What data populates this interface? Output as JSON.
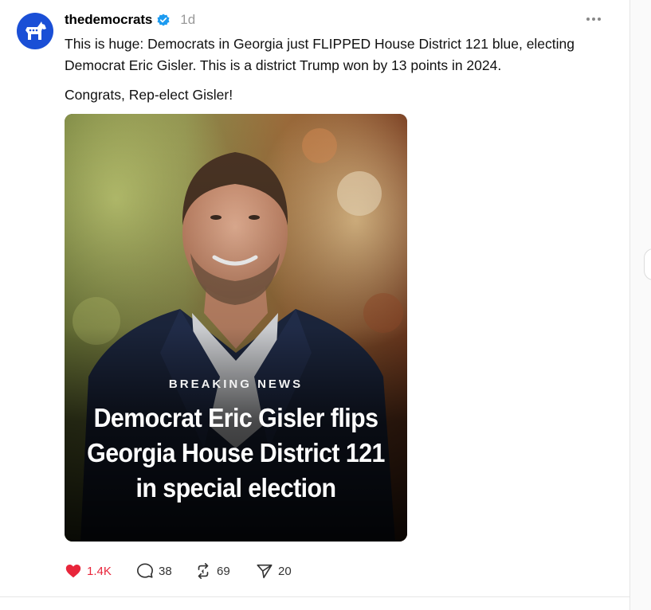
{
  "post": {
    "username": "thedemocrats",
    "timestamp": "1d",
    "paragraphs": [
      "This is huge: Democrats in Georgia just FLIPPED House District 121 blue, electing Democrat Eric Gisler. This is a district Trump won by 13 points in 2024.",
      "Congrats, Rep-elect Gisler!"
    ],
    "image": {
      "kicker": "BREAKING NEWS",
      "headline": "Democrat Eric Gisler flips Georgia House District 121 in special election"
    },
    "actions": {
      "likes": "1.4K",
      "replies": "38",
      "reposts": "69",
      "shares": "20"
    }
  },
  "icons": {
    "avatar": "democrats-donkey-logo",
    "verified": "verified-badge-icon",
    "more": "more-options-icon",
    "like": "heart-icon",
    "reply": "comment-icon",
    "repost": "repost-icon",
    "share": "send-icon"
  },
  "colors": {
    "avatar_bg": "#1a4fd6",
    "verified": "#1d9bf0",
    "like_active": "#e8263b",
    "muted": "#999999"
  }
}
